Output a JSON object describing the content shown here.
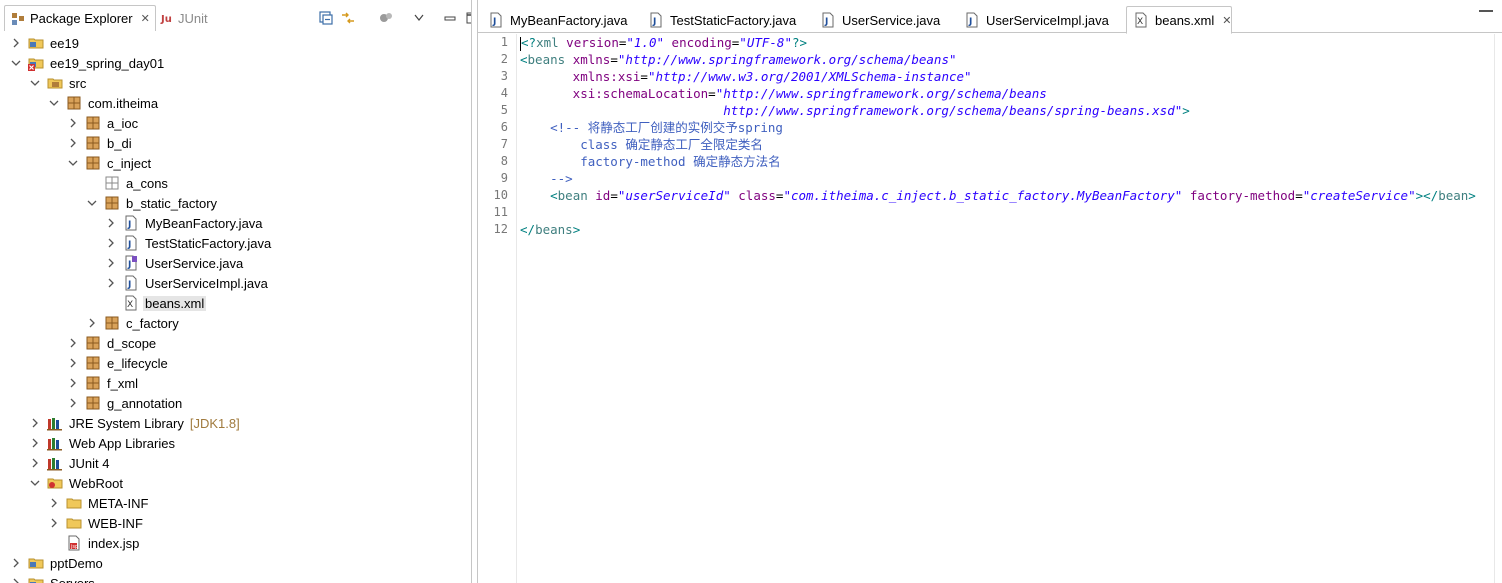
{
  "explorer": {
    "tabs": [
      {
        "label": "Package Explorer",
        "active": true
      },
      {
        "label": "JUnit",
        "active": false
      }
    ],
    "toolbar": [
      "collapse-all-icon",
      "link-with-editor-icon",
      "focus-icon",
      "view-menu-icon",
      "minimize-icon",
      "maximize-icon"
    ],
    "tree": [
      {
        "label": "ee19",
        "depth": 0,
        "toggle": "collapsed",
        "icon": "project-icon"
      },
      {
        "label": "ee19_spring_day01",
        "depth": 0,
        "toggle": "expanded",
        "icon": "project-error-icon"
      },
      {
        "label": "src",
        "depth": 1,
        "toggle": "expanded",
        "icon": "source-folder-icon"
      },
      {
        "label": "com.itheima",
        "depth": 2,
        "toggle": "expanded",
        "icon": "package-icon"
      },
      {
        "label": "a_ioc",
        "depth": 3,
        "toggle": "collapsed",
        "icon": "package-icon"
      },
      {
        "label": "b_di",
        "depth": 3,
        "toggle": "collapsed",
        "icon": "package-icon"
      },
      {
        "label": "c_inject",
        "depth": 3,
        "toggle": "expanded",
        "icon": "package-icon"
      },
      {
        "label": "a_cons",
        "depth": 4,
        "toggle": "none",
        "icon": "empty-package-icon"
      },
      {
        "label": "b_static_factory",
        "depth": 4,
        "toggle": "expanded",
        "icon": "package-icon"
      },
      {
        "label": "MyBeanFactory.java",
        "depth": 5,
        "toggle": "collapsed",
        "icon": "java-file-icon"
      },
      {
        "label": "TestStaticFactory.java",
        "depth": 5,
        "toggle": "collapsed",
        "icon": "java-file-icon"
      },
      {
        "label": "UserService.java",
        "depth": 5,
        "toggle": "collapsed",
        "icon": "java-interface-file-icon"
      },
      {
        "label": "UserServiceImpl.java",
        "depth": 5,
        "toggle": "collapsed",
        "icon": "java-file-icon"
      },
      {
        "label": "beans.xml",
        "depth": 5,
        "toggle": "none",
        "icon": "xml-file-icon",
        "selected": true
      },
      {
        "label": "c_factory",
        "depth": 4,
        "toggle": "collapsed",
        "icon": "package-icon"
      },
      {
        "label": "d_scope",
        "depth": 3,
        "toggle": "collapsed",
        "icon": "package-icon"
      },
      {
        "label": "e_lifecycle",
        "depth": 3,
        "toggle": "collapsed",
        "icon": "package-icon"
      },
      {
        "label": "f_xml",
        "depth": 3,
        "toggle": "collapsed",
        "icon": "package-icon"
      },
      {
        "label": "g_annotation",
        "depth": 3,
        "toggle": "collapsed",
        "icon": "package-icon"
      },
      {
        "label": "JRE System Library",
        "decoration": "[JDK1.8]",
        "depth": 1,
        "toggle": "collapsed",
        "icon": "library-icon"
      },
      {
        "label": "Web App Libraries",
        "depth": 1,
        "toggle": "collapsed",
        "icon": "library-icon"
      },
      {
        "label": "JUnit 4",
        "depth": 1,
        "toggle": "collapsed",
        "icon": "library-icon"
      },
      {
        "label": "WebRoot",
        "depth": 1,
        "toggle": "expanded",
        "icon": "webroot-folder-icon"
      },
      {
        "label": "META-INF",
        "depth": 2,
        "toggle": "collapsed",
        "icon": "folder-icon"
      },
      {
        "label": "WEB-INF",
        "depth": 2,
        "toggle": "collapsed",
        "icon": "folder-icon"
      },
      {
        "label": "index.jsp",
        "depth": 2,
        "toggle": "none",
        "icon": "jsp-file-icon"
      },
      {
        "label": "pptDemo",
        "depth": 0,
        "toggle": "collapsed",
        "icon": "project-icon"
      },
      {
        "label": "Servers",
        "depth": 0,
        "toggle": "collapsed",
        "icon": "project-icon"
      }
    ]
  },
  "editor": {
    "tabs": [
      {
        "label": "MyBeanFactory.java",
        "icon": "java-file-icon",
        "active": false
      },
      {
        "label": "TestStaticFactory.java",
        "icon": "java-file-icon",
        "active": false
      },
      {
        "label": "UserService.java",
        "icon": "java-file-icon",
        "active": false
      },
      {
        "label": "UserServiceImpl.java",
        "icon": "java-file-icon",
        "active": false
      },
      {
        "label": "beans.xml",
        "icon": "xml-file-icon",
        "active": true
      }
    ],
    "line_numbers": [
      "1",
      "2",
      "3",
      "4",
      "5",
      "6",
      "7",
      "8",
      "9",
      "10",
      "11",
      "12"
    ],
    "lines": [
      [
        {
          "t": "<?",
          "c": "punc"
        },
        {
          "t": "xml",
          "c": "tag"
        },
        {
          "t": " version",
          "c": "attr"
        },
        {
          "t": "=",
          "c": "plain"
        },
        {
          "t": "\"1.0\"",
          "c": "val"
        },
        {
          "t": " encoding",
          "c": "attr"
        },
        {
          "t": "=",
          "c": "plain"
        },
        {
          "t": "\"UTF-8\"",
          "c": "val"
        },
        {
          "t": "?>",
          "c": "punc"
        }
      ],
      [
        {
          "t": "<",
          "c": "punc"
        },
        {
          "t": "beans",
          "c": "tag"
        },
        {
          "t": " xmlns",
          "c": "attr"
        },
        {
          "t": "=",
          "c": "plain"
        },
        {
          "t": "\"http://www.springframework.org/schema/beans\"",
          "c": "val"
        }
      ],
      [
        {
          "t": "       xmlns:xsi",
          "c": "attr"
        },
        {
          "t": "=",
          "c": "plain"
        },
        {
          "t": "\"http://www.w3.org/2001/XMLSchema-instance\"",
          "c": "val"
        }
      ],
      [
        {
          "t": "       xsi:schemaLocation",
          "c": "attr"
        },
        {
          "t": "=",
          "c": "plain"
        },
        {
          "t": "\"http://www.springframework.org/schema/beans",
          "c": "val"
        }
      ],
      [
        {
          "t": "                           http://www.springframework.org/schema/beans/spring-beans.xsd\"",
          "c": "val"
        },
        {
          "t": ">",
          "c": "punc"
        }
      ],
      [
        {
          "t": "    <!-- ",
          "c": "cmt"
        },
        {
          "t": "将静态工厂创建的实例交予",
          "c": "cmt-cn"
        },
        {
          "t": "spring",
          "c": "cmt"
        }
      ],
      [
        {
          "t": "        class ",
          "c": "cmt"
        },
        {
          "t": "确定静态工厂全限定类名",
          "c": "cmt-cn"
        }
      ],
      [
        {
          "t": "        factory-method ",
          "c": "cmt"
        },
        {
          "t": "确定静态方法名",
          "c": "cmt-cn"
        }
      ],
      [
        {
          "t": "    -->",
          "c": "cmt"
        }
      ],
      [
        {
          "t": "    <",
          "c": "punc"
        },
        {
          "t": "bean",
          "c": "tag"
        },
        {
          "t": " id",
          "c": "attr"
        },
        {
          "t": "=",
          "c": "plain"
        },
        {
          "t": "\"userServiceId\"",
          "c": "val"
        },
        {
          "t": " class",
          "c": "attr"
        },
        {
          "t": "=",
          "c": "plain"
        },
        {
          "t": "\"com.itheima.c_inject.b_static_factory.MyBeanFactory\"",
          "c": "val"
        },
        {
          "t": " factory-method",
          "c": "attr"
        },
        {
          "t": "=",
          "c": "plain"
        },
        {
          "t": "\"createService\"",
          "c": "val"
        },
        {
          "t": "></",
          "c": "punc"
        },
        {
          "t": "bean",
          "c": "tag"
        },
        {
          "t": ">",
          "c": "punc"
        }
      ],
      [],
      [
        {
          "t": "</",
          "c": "punc"
        },
        {
          "t": "beans",
          "c": "tag"
        },
        {
          "t": ">",
          "c": "punc"
        }
      ]
    ]
  },
  "colors": {
    "selection": "#e5e5e5",
    "tag": "#3f7f7f",
    "attribute": "#7f007f",
    "value": "#2a00ff",
    "comment": "#3f5fbf"
  }
}
